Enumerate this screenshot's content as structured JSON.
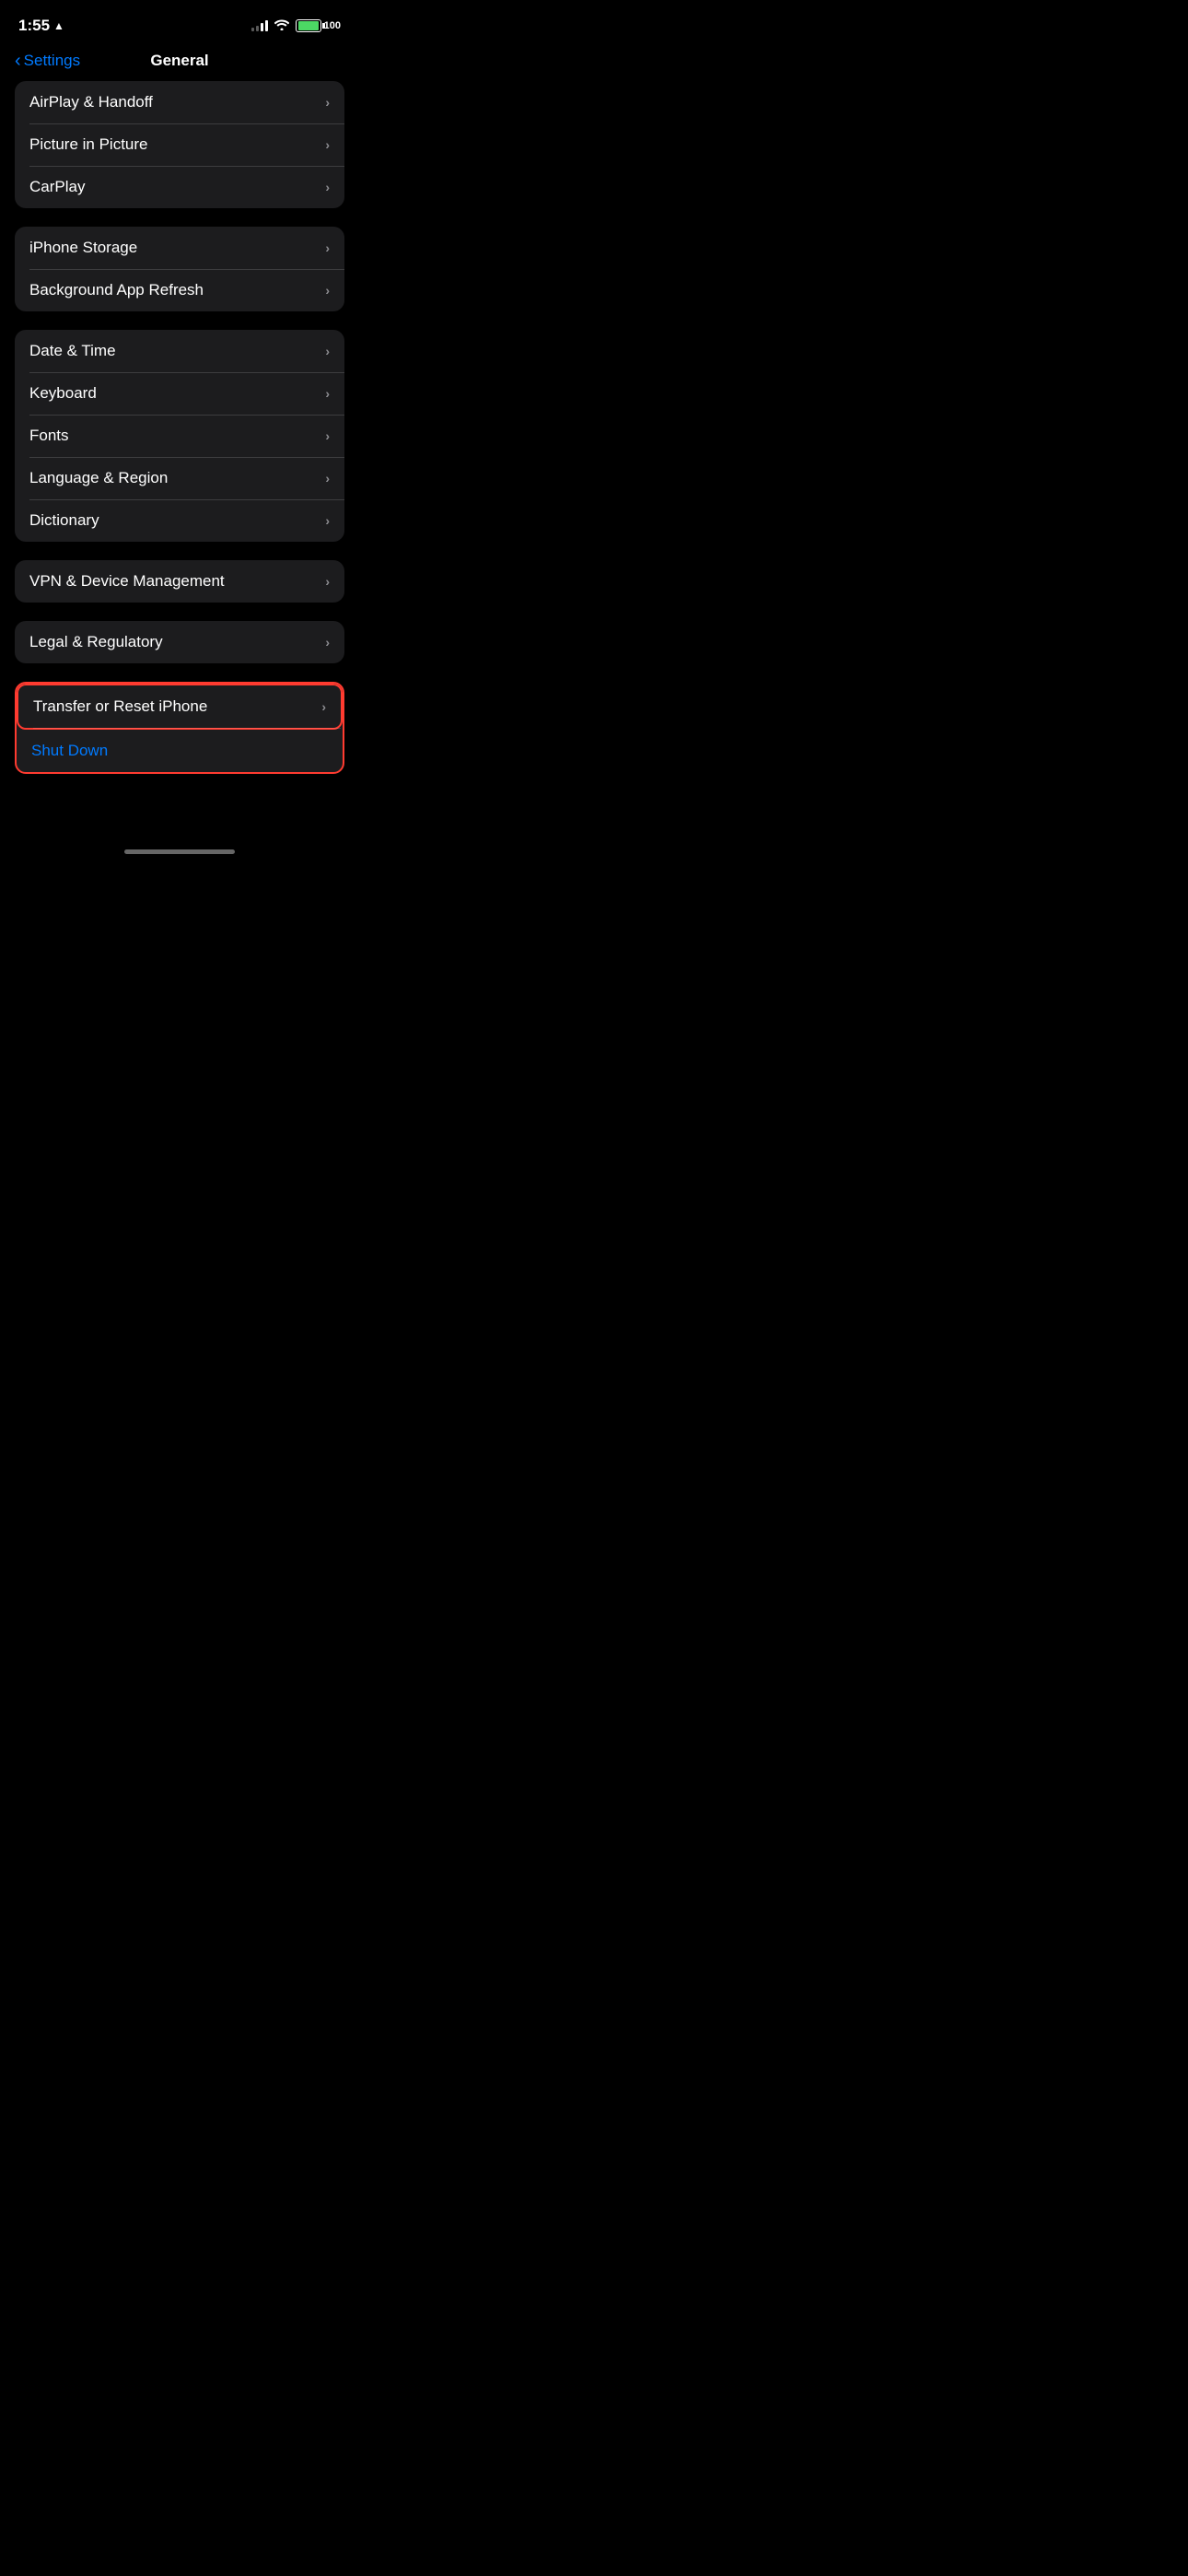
{
  "status": {
    "time": "1:55",
    "battery_label": "100",
    "battery_percent": 100
  },
  "navigation": {
    "back_label": "Settings",
    "title": "General"
  },
  "groups": [
    {
      "id": "group-airplay",
      "highlighted": false,
      "rows": [
        {
          "id": "airplay-handoff",
          "label": "AirPlay & Handoff",
          "value": "",
          "chevron": true
        },
        {
          "id": "picture-in-picture",
          "label": "Picture in Picture",
          "value": "",
          "chevron": true
        },
        {
          "id": "carplay",
          "label": "CarPlay",
          "value": "",
          "chevron": true
        }
      ]
    },
    {
      "id": "group-storage",
      "highlighted": false,
      "rows": [
        {
          "id": "iphone-storage",
          "label": "iPhone Storage",
          "value": "",
          "chevron": true
        },
        {
          "id": "background-app-refresh",
          "label": "Background App Refresh",
          "value": "",
          "chevron": true
        }
      ]
    },
    {
      "id": "group-language",
      "highlighted": false,
      "rows": [
        {
          "id": "date-time",
          "label": "Date & Time",
          "value": "",
          "chevron": true
        },
        {
          "id": "keyboard",
          "label": "Keyboard",
          "value": "",
          "chevron": true
        },
        {
          "id": "fonts",
          "label": "Fonts",
          "value": "",
          "chevron": true
        },
        {
          "id": "language-region",
          "label": "Language & Region",
          "value": "",
          "chevron": true
        },
        {
          "id": "dictionary",
          "label": "Dictionary",
          "value": "",
          "chevron": true
        }
      ]
    },
    {
      "id": "group-vpn",
      "highlighted": false,
      "rows": [
        {
          "id": "vpn-device-management",
          "label": "VPN & Device Management",
          "value": "",
          "chevron": true
        }
      ]
    },
    {
      "id": "group-legal",
      "highlighted": false,
      "rows": [
        {
          "id": "legal-regulatory",
          "label": "Legal & Regulatory",
          "value": "",
          "chevron": true
        }
      ]
    },
    {
      "id": "group-transfer",
      "highlighted": true,
      "rows": [
        {
          "id": "transfer-reset",
          "label": "Transfer or Reset iPhone",
          "value": "",
          "chevron": true
        },
        {
          "id": "shut-down",
          "label": "Shut Down",
          "value": "",
          "chevron": false,
          "blue": true
        }
      ]
    }
  ]
}
